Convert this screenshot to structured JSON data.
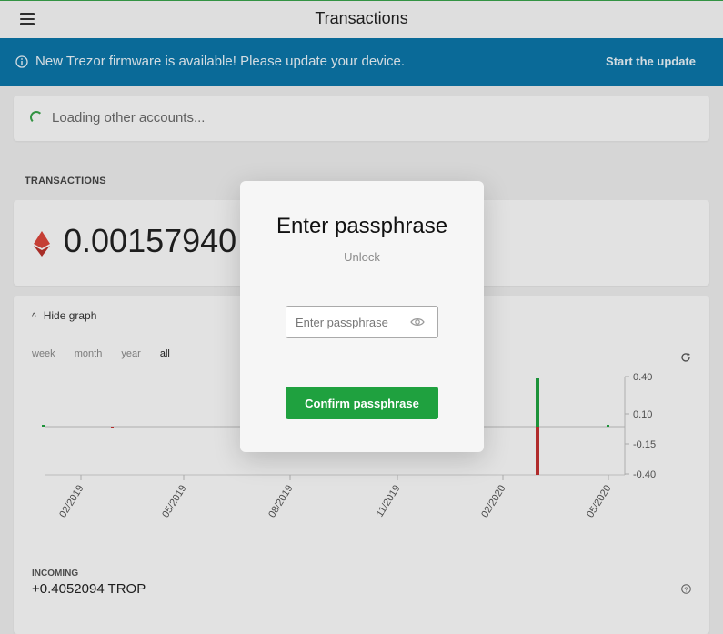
{
  "topbar": {
    "title": "Transactions"
  },
  "banner": {
    "message": "New Trezor firmware is available! Please update your device.",
    "action": "Start the update",
    "color": "#0c75a8"
  },
  "loading": {
    "text": "Loading other accounts..."
  },
  "transactions": {
    "section_label": "TRANSACTIONS",
    "balance": "0.00157940",
    "coin_icon": "ethereum-icon"
  },
  "graph": {
    "toggle_label": "Hide graph",
    "ranges": [
      "week",
      "month",
      "year",
      "all"
    ],
    "active_range": "all"
  },
  "chart_data": {
    "type": "bar",
    "x_tick_labels": [
      "02/2019",
      "05/2019",
      "08/2019",
      "11/2019",
      "02/2020",
      "05/2020"
    ],
    "y_tick_labels": [
      "0.40",
      "0.10",
      "-0.15",
      "-0.40"
    ],
    "ylim": [
      -0.4,
      0.4
    ],
    "series": [
      {
        "color": "#1fa13f",
        "points": [
          {
            "x": "12/2018",
            "y": 0.01
          },
          {
            "x": "03/2020",
            "y": 0.4052094
          },
          {
            "x": "05/2020",
            "y": 0.01
          }
        ]
      },
      {
        "color": "#c23030",
        "points": [
          {
            "x": "01/2019",
            "y": -0.01
          },
          {
            "x": "03/2020",
            "y": -0.4
          }
        ]
      }
    ]
  },
  "incoming": {
    "label": "INCOMING",
    "value": "+0.4052094 TROP"
  },
  "modal": {
    "title": "Enter passphrase",
    "subtitle": "Unlock",
    "placeholder": "Enter passphrase",
    "confirm_label": "Confirm passphrase",
    "button_color": "#1fa13f"
  }
}
